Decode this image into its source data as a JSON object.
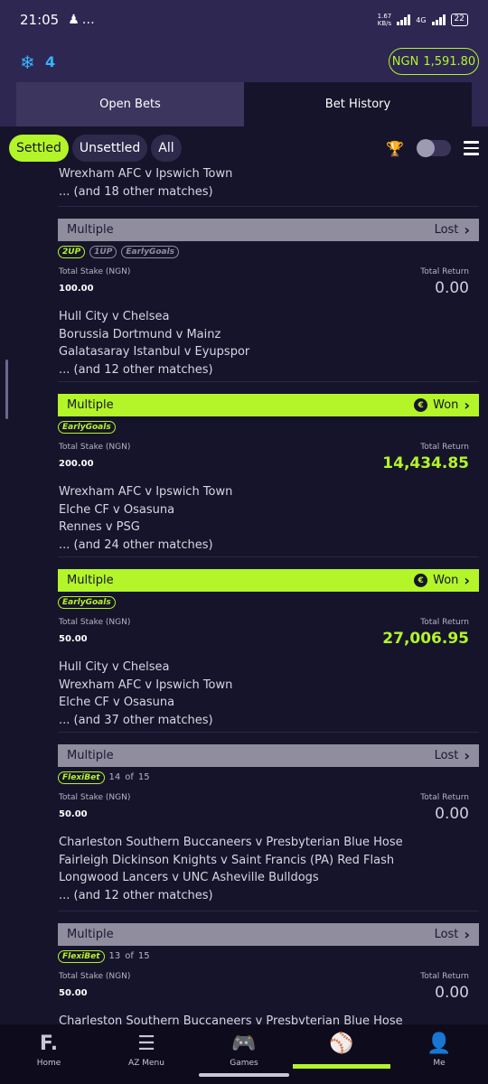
{
  "status_bar": {
    "time": "21:05",
    "net_speed_value": "1.67",
    "net_speed_unit": "KB/s",
    "network": "4G",
    "battery": "22"
  },
  "header": {
    "snow_count": "4",
    "balance_currency": "NGN",
    "balance_amount": "1,591.80"
  },
  "tabs": [
    {
      "label": "Open Bets"
    },
    {
      "label": "Bet History"
    }
  ],
  "filters": [
    {
      "label": "Settled"
    },
    {
      "label": "Unsettled"
    },
    {
      "label": "All"
    }
  ],
  "top_matches": [
    "Wrexham AFC v Ipswich Town",
    "... (and 18 other matches)"
  ],
  "bets": [
    {
      "type": "Multiple",
      "status": "Lost",
      "badges": [
        "2UP",
        "1UP",
        "EarlyGoals"
      ],
      "stake_label": "Total Stake (NGN)",
      "stake": "100.00",
      "return_label": "Total Return",
      "return": "0.00",
      "matches": [
        "Hull City v Chelsea",
        "Borussia Dortmund v Mainz",
        "Galatasaray Istanbul v Eyupspor",
        "... (and 12 other matches)"
      ]
    },
    {
      "type": "Multiple",
      "status": "Won",
      "badges": [
        "EarlyGoals"
      ],
      "stake_label": "Total Stake (NGN)",
      "stake": "200.00",
      "return_label": "Total Return",
      "return": "14,434.85",
      "matches": [
        "Wrexham AFC v Ipswich Town",
        "Elche CF v Osasuna",
        "Rennes v PSG",
        "... (and 24 other matches)"
      ]
    },
    {
      "type": "Multiple",
      "status": "Won",
      "badges": [
        "EarlyGoals"
      ],
      "stake_label": "Total Stake (NGN)",
      "stake": "50.00",
      "return_label": "Total Return",
      "return": "27,006.95",
      "matches": [
        "Hull City v Chelsea",
        "Wrexham AFC v Ipswich Town",
        "Elche CF v Osasuna",
        "... (and 37 other matches)"
      ]
    },
    {
      "type": "Multiple",
      "status": "Lost",
      "badges": [
        "FlexiBet"
      ],
      "flexi_count": "14",
      "flexi_of": "of",
      "flexi_total": "15",
      "stake_label": "Total Stake (NGN)",
      "stake": "50.00",
      "return_label": "Total Return",
      "return": "0.00",
      "matches": [
        "Charleston Southern Buccaneers v Presbyterian Blue Hose",
        "Fairleigh Dickinson Knights v Saint Francis (PA) Red Flash",
        "Longwood Lancers v UNC Asheville Bulldogs",
        "... (and 12 other matches)"
      ]
    },
    {
      "type": "Multiple",
      "status": "Lost",
      "badges": [
        "FlexiBet"
      ],
      "flexi_count": "13",
      "flexi_of": "of",
      "flexi_total": "15",
      "stake_label": "Total Stake (NGN)",
      "stake": "50.00",
      "return_label": "Total Return",
      "return": "0.00",
      "matches": [
        "Charleston Southern Buccaneers v Presbyterian Blue Hose"
      ]
    }
  ],
  "bottom_nav": [
    {
      "label": "Home"
    },
    {
      "label": "AZ Menu"
    },
    {
      "label": "Games"
    },
    {
      "label": ""
    },
    {
      "label": "Me"
    }
  ],
  "colors": {
    "accent": "#b3f529",
    "lost_bar": "#8f8d9e",
    "background": "#16142a",
    "header": "#2d2752"
  }
}
